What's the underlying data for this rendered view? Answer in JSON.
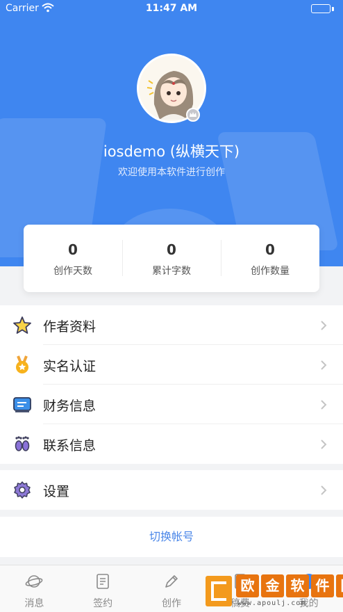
{
  "status_bar": {
    "carrier": "Carrier",
    "time": "11:47 AM"
  },
  "colors": {
    "primary": "#3f86f0",
    "link": "#4a86e8",
    "watermark": "#e8740f"
  },
  "profile": {
    "username": "iosdemo (纵横天下)",
    "welcome": "欢迎使用本软件进行创作"
  },
  "stats": [
    {
      "value": "0",
      "label": "创作天数"
    },
    {
      "value": "0",
      "label": "累计字数"
    },
    {
      "value": "0",
      "label": "创作数量"
    }
  ],
  "menu": [
    {
      "label": "作者资料",
      "icon": "star-icon"
    },
    {
      "label": "实名认证",
      "icon": "medal-icon"
    },
    {
      "label": "财务信息",
      "icon": "card-icon"
    },
    {
      "label": "联系信息",
      "icon": "footprints-icon"
    }
  ],
  "settings": {
    "label": "设置",
    "icon": "gear-icon"
  },
  "switch_account": "切换帐号",
  "tabs": [
    {
      "label": "消息",
      "icon": "planet-icon"
    },
    {
      "label": "签约",
      "icon": "contract-icon"
    },
    {
      "label": "创作",
      "icon": "pen-icon"
    },
    {
      "label": "稿费",
      "icon": "document-icon"
    },
    {
      "label": "我的",
      "icon": "profile-globe-icon"
    }
  ],
  "watermark": {
    "chars": [
      "欧",
      "金",
      "软",
      "件",
      "园"
    ],
    "url": "www.apoulj.com"
  }
}
